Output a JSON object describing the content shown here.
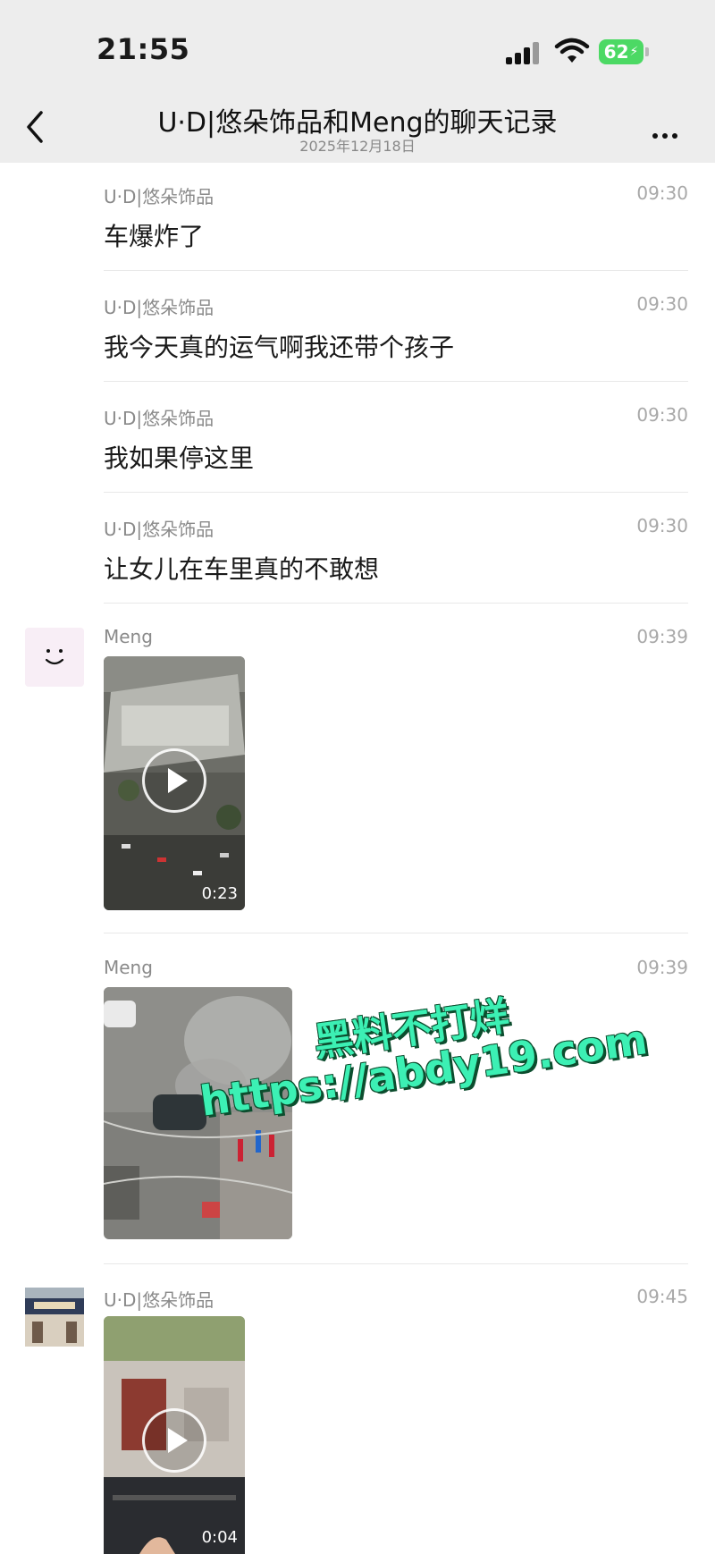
{
  "status_bar": {
    "time": "21:55",
    "battery": "62"
  },
  "nav": {
    "title": "U·D|悠朵饰品和Meng的聊天记录",
    "subtitle": "2025年12月18日"
  },
  "messages": [
    {
      "sender": "U·D|悠朵饰品",
      "time": "09:30",
      "text": "车爆炸了"
    },
    {
      "sender": "U·D|悠朵饰品",
      "time": "09:30",
      "text": "我今天真的运气啊我还带个孩子"
    },
    {
      "sender": "U·D|悠朵饰品",
      "time": "09:30",
      "text": "我如果停这里"
    },
    {
      "sender": "U·D|悠朵饰品",
      "time": "09:30",
      "text": "让女儿在车里真的不敢想"
    },
    {
      "sender": "Meng",
      "time": "09:39",
      "video_duration": "0:23"
    },
    {
      "sender": "Meng",
      "time": "09:39"
    },
    {
      "sender": "U·D|悠朵饰品",
      "time": "09:45",
      "video_duration": "0:04"
    }
  ],
  "watermark": {
    "line1": "黑料不打烊",
    "line2": "https://abdy19.com"
  },
  "colors": {
    "nav_bg": "#ededed",
    "battery_green": "#4cd964",
    "watermark": "#3cf0b4"
  }
}
